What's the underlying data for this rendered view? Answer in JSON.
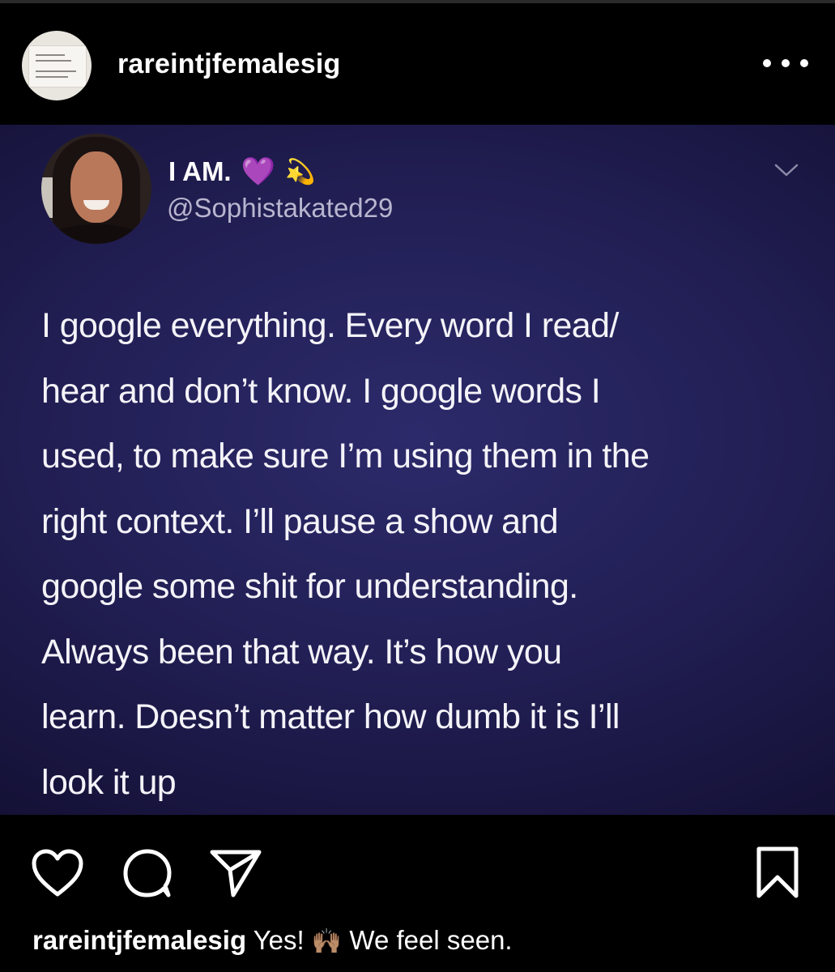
{
  "header": {
    "username": "rareintjfemalesig",
    "more_icon": "more-horizontal-icon"
  },
  "tweet": {
    "display_name": "I AM.",
    "name_emoji_1": "💜",
    "name_emoji_2": "💫",
    "handle": "@Sophistakated29",
    "menu_icon": "chevron-down-icon",
    "lines": [
      "I google everything. Every word I read/",
      "hear and don’t know. I google words I",
      "used, to make sure I’m using them in the",
      "right context. I’ll pause a show and",
      "google some shit for understanding.",
      "Always been that way. It’s how you",
      "learn. Doesn’t matter how dumb it is I’ll",
      "look it up"
    ],
    "colors": {
      "background": "#221f55",
      "text": "#f4f3f8",
      "handle": "#b8b5cf"
    }
  },
  "actions": {
    "icons": [
      "heart-icon",
      "comment-icon",
      "share-icon",
      "bookmark-icon"
    ]
  },
  "caption": {
    "username": "rareintjfemalesig",
    "text_before": "Yes!",
    "emoji": "🙌🏽",
    "text_after": "We feel seen."
  }
}
